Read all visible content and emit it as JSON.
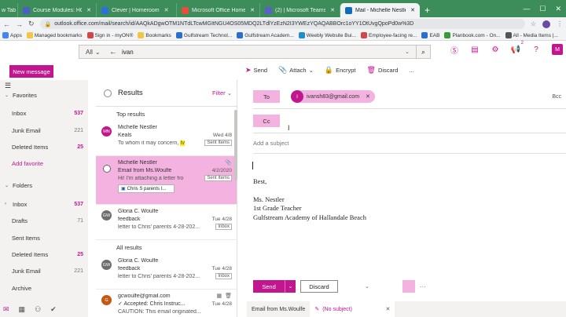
{
  "browser": {
    "tabs": [
      {
        "label": "w Tab",
        "color": "#bbbbbb"
      },
      {
        "label": "Course Modules: HOMEROO",
        "color": "#4b5fc4"
      },
      {
        "label": "Clever | Homeroom",
        "color": "#2d6fdc"
      },
      {
        "label": "Microsoft Office Home",
        "color": "#e74c3c"
      },
      {
        "label": "(2) | Microsoft Teams",
        "color": "#5b5fc7"
      },
      {
        "label": "Mail - Michelle Nestler - Out",
        "color": "#0f6cbd"
      }
    ],
    "url": "outlook.office.com/mail/search/id/AAQkADgwOTM1NTdLTcwMGItNGU4OS05MDQ2LTdlYzEzN2I3YWEzYQAQABBOrc1oYY1OtUvgQpoPd0w%3D",
    "bookmarks": [
      {
        "label": "Apps",
        "color": "#4285f4"
      },
      {
        "label": "Managed bookmarks",
        "color": "#f4c542"
      },
      {
        "label": "Sign in - myON®",
        "color": "#d64545"
      },
      {
        "label": "Bookmarks",
        "color": "#f4c542"
      },
      {
        "label": "Gulfstream Technol...",
        "color": "#2a6fcf"
      },
      {
        "label": "Gulfstream Academ...",
        "color": "#2a6fcf"
      },
      {
        "label": "Weebly Website Bui...",
        "color": "#1f8ecd"
      },
      {
        "label": "Employee-facing re...",
        "color": "#d64545"
      },
      {
        "label": "EAB",
        "color": "#2a6fcf"
      },
      {
        "label": "Planbook.com - On...",
        "color": "#3a9a3a"
      },
      {
        "label": "All - Media Items |...",
        "color": "#555555"
      }
    ]
  },
  "search": {
    "scope": "All",
    "query": "ivan"
  },
  "header": {
    "initial": "M",
    "badge_count": "2"
  },
  "toolbar": {
    "new_message": "New message",
    "send": "Send",
    "attach": "Attach",
    "encrypt": "Encrypt",
    "discard": "Discard",
    "more": "..."
  },
  "nav": {
    "favorites": "Favorites",
    "folders": "Folders",
    "add_favorite": "Add favorite",
    "fav_items": [
      {
        "label": "Inbox",
        "count": "537",
        "hi": true
      },
      {
        "label": "Junk Email",
        "count": "221",
        "hi": false
      },
      {
        "label": "Deleted Items",
        "count": "25",
        "hi": true
      }
    ],
    "folder_items": [
      {
        "label": "Inbox",
        "count": "537",
        "hi": true
      },
      {
        "label": "Drafts",
        "count": "71",
        "hi": false
      },
      {
        "label": "Sent Items",
        "count": "",
        "hi": false
      },
      {
        "label": "Deleted Items",
        "count": "25",
        "hi": true
      },
      {
        "label": "Junk Email",
        "count": "221",
        "hi": false
      },
      {
        "label": "Archive",
        "count": "",
        "hi": false
      }
    ]
  },
  "list": {
    "title": "Results",
    "filter": "Filter",
    "top_results": "Top results",
    "all_results": "All results",
    "items": [
      {
        "initials": "MN",
        "av_color": "#c2168e",
        "sender": "Michelle Nestler",
        "subject": "Keals",
        "date": "Wed 4/8",
        "preview": "To whom it may concern,",
        "highlight": "Iv",
        "tag": "Sent Items"
      },
      {
        "sender": "Michelle Nestler",
        "subject": "Email from Ms.Woulfe",
        "date": "4/2/2020",
        "preview": "Hi! I'm attaching a letter fro",
        "tag": "Sent Items",
        "attachment": "Chris S parents l..."
      },
      {
        "initials": "GW",
        "av_color": "#6e6e6e",
        "sender": "Gloria C. Woulfe",
        "subject": "feedback",
        "date": "Tue 4/28",
        "preview": "letter to Chris' parents 4-28-202...",
        "tag": "Inbox"
      },
      {
        "initials": "GW",
        "av_color": "#6e6e6e",
        "sender": "Gloria C. Woulfe",
        "subject": "feedback",
        "date": "Tue 4/28",
        "preview": "letter to Chris' parents 4-28-202...",
        "tag": "Inbox"
      },
      {
        "initials": "G",
        "av_color": "#c25a14",
        "sender": "gcwoulfe@gmail.com",
        "subject": "Accepted: Chris Instruc...",
        "date": "Tue 4/28",
        "preview": "CAUTION: This email originated..."
      }
    ]
  },
  "compose": {
    "to_label": "To",
    "cc_label": "Cc",
    "bcc_label": "Bcc",
    "recipient_initial": "I",
    "recipient": "ivansh83@gmail.com",
    "subject_placeholder": "Add a subject",
    "body": {
      "greeting": "Best,",
      "name": "Ms. Nestler",
      "role": "1st Grade Teacher",
      "school": "Gulfstream Academy of Hallandale Beach"
    },
    "send": "Send",
    "discard": "Discard"
  },
  "bottom_tabs": {
    "first": "Email from Ms.Woulfe",
    "second": "(No subject)"
  }
}
